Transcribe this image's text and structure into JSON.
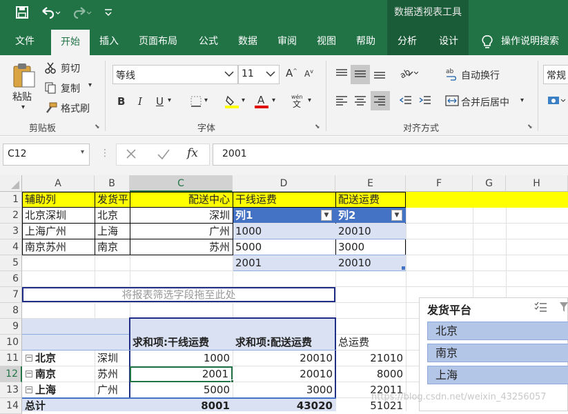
{
  "title_bar": {
    "context_title": "数据透视表工具"
  },
  "tabs": [
    {
      "label": "文件"
    },
    {
      "label": "开始"
    },
    {
      "label": "插入"
    },
    {
      "label": "页面布局"
    },
    {
      "label": "公式"
    },
    {
      "label": "数据"
    },
    {
      "label": "审阅"
    },
    {
      "label": "视图"
    },
    {
      "label": "帮助"
    },
    {
      "label": "分析"
    },
    {
      "label": "设计"
    },
    {
      "label": "操作说明搜索"
    }
  ],
  "ribbon": {
    "clipboard": {
      "paste": "粘贴",
      "cut": "剪切",
      "copy": "复制",
      "format_painter": "格式刷",
      "group": "剪贴板"
    },
    "font": {
      "name": "等线",
      "size": "11",
      "bold": "B",
      "italic": "I",
      "underline": "U",
      "group": "字体"
    },
    "alignment": {
      "wrap": "自动换行",
      "merge": "合并后居中",
      "group": "对齐方式"
    },
    "number": {
      "format": "常规"
    }
  },
  "formula_bar": {
    "name_box": "C12",
    "formula": "2001"
  },
  "columns": [
    "A",
    "B",
    "C",
    "D",
    "E",
    "F",
    "G",
    "H"
  ],
  "rows": [
    "1",
    "2",
    "3",
    "4",
    "5",
    "6",
    "7",
    "8",
    "9",
    "10",
    "11",
    "12",
    "13",
    "14"
  ],
  "sheet": {
    "r1": {
      "a": "辅助列",
      "b": "发货平",
      "c": "配送中心",
      "d": "干线运费",
      "e": "配送运费"
    },
    "r2": {
      "a": "北京深圳",
      "b": "北京",
      "c": "深圳",
      "d": "列1",
      "e": "列2"
    },
    "r3": {
      "a": "上海广州",
      "b": "上海",
      "c": "广州",
      "d": "1000",
      "e": "20010"
    },
    "r4": {
      "a": "南京苏州",
      "b": "南京",
      "c": "苏州",
      "d": "5000",
      "e": "3000"
    },
    "r5": {
      "d": "2001",
      "e": "20010"
    },
    "r7": {
      "filter_hint": "将报表筛选字段拖至此处"
    },
    "r10": {
      "c": "求和项:干线运费",
      "d": "求和项:配送运费",
      "e": "总运费"
    },
    "r11": {
      "a": "北京",
      "b": "深圳",
      "c": "1000",
      "d": "20010",
      "e": "21010"
    },
    "r12": {
      "a": "南京",
      "b": "苏州",
      "c": "2001",
      "d": "20010",
      "e": "8000"
    },
    "r13": {
      "a": "上海",
      "b": "广州",
      "c": "5000",
      "d": "3000",
      "e": "22011"
    },
    "r14": {
      "a": "总计",
      "c": "8001",
      "d": "43020",
      "e": "51021"
    }
  },
  "slicer": {
    "title": "发货平台",
    "items": [
      "北京",
      "南京",
      "上海"
    ]
  },
  "watermark": "https://blog.csdn.net/weixin_43256057",
  "colors": {
    "excel_green": "#217346",
    "yellow_fill": "#ffff00",
    "table_header": "#4472c4",
    "table_band": "#d9e1f2",
    "slicer_item": "#b4c6e7"
  }
}
